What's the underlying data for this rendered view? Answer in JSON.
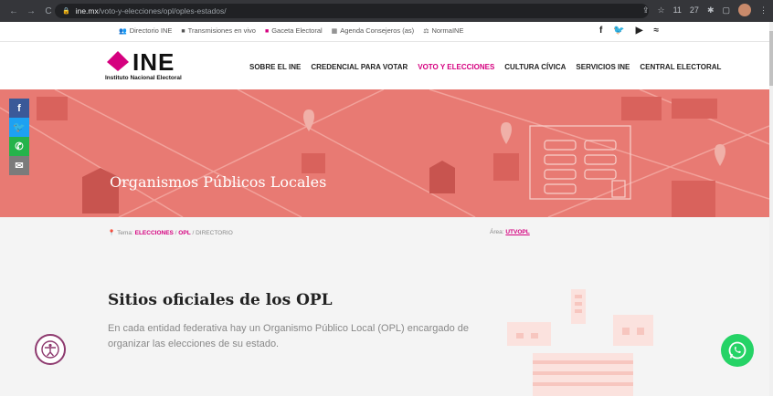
{
  "browser": {
    "url_host": "ine.mx",
    "url_path": "/voto-y-elecciones/opl/oples-estados/",
    "clock_h": "11",
    "clock_m": "27"
  },
  "topbar": {
    "links": [
      {
        "label": "Directorio INE",
        "icon": "people-icon"
      },
      {
        "label": "Transmisiones en vivo",
        "icon": "video-icon"
      },
      {
        "label": "Gaceta Electoral",
        "icon": "gaceta-icon"
      },
      {
        "label": "Agenda Consejeros (as)",
        "icon": "calendar-icon"
      },
      {
        "label": "NormaINE",
        "icon": "scales-icon"
      }
    ],
    "social": [
      "f",
      "🐦",
      "▶",
      "≈"
    ]
  },
  "logo": {
    "word": "INE",
    "subtitle": "Instituto Nacional Electoral"
  },
  "menu": [
    {
      "label": "SOBRE EL INE",
      "active": false
    },
    {
      "label": "CREDENCIAL PARA VOTAR",
      "active": false
    },
    {
      "label": "VOTO Y ELECCIONES",
      "active": true
    },
    {
      "label": "CULTURA CÍVICA",
      "active": false
    },
    {
      "label": "SERVICIOS INE",
      "active": false
    },
    {
      "label": "CENTRAL ELECTORAL",
      "active": false
    }
  ],
  "hero": {
    "title": "Organismos Públicos Locales"
  },
  "share": [
    "f",
    "🐦",
    "✆",
    "✉"
  ],
  "breadcrumb": {
    "prefix": "Tema:",
    "item1": "ELECCIONES",
    "sep1": " / ",
    "item2": "OPL",
    "sep2": " / ",
    "item3": "DIRECTORIO"
  },
  "area": {
    "label": "Área:",
    "value": "UTVOPL"
  },
  "section": {
    "title": "Sitios oficiales de los OPL",
    "text": "En cada entidad federativa hay un Organismo Público Local (OPL) encargado de organizar las elecciones de su estado."
  },
  "colors": {
    "brand": "#d5007f",
    "hero": "#e87a73",
    "whatsapp": "#25d366"
  }
}
